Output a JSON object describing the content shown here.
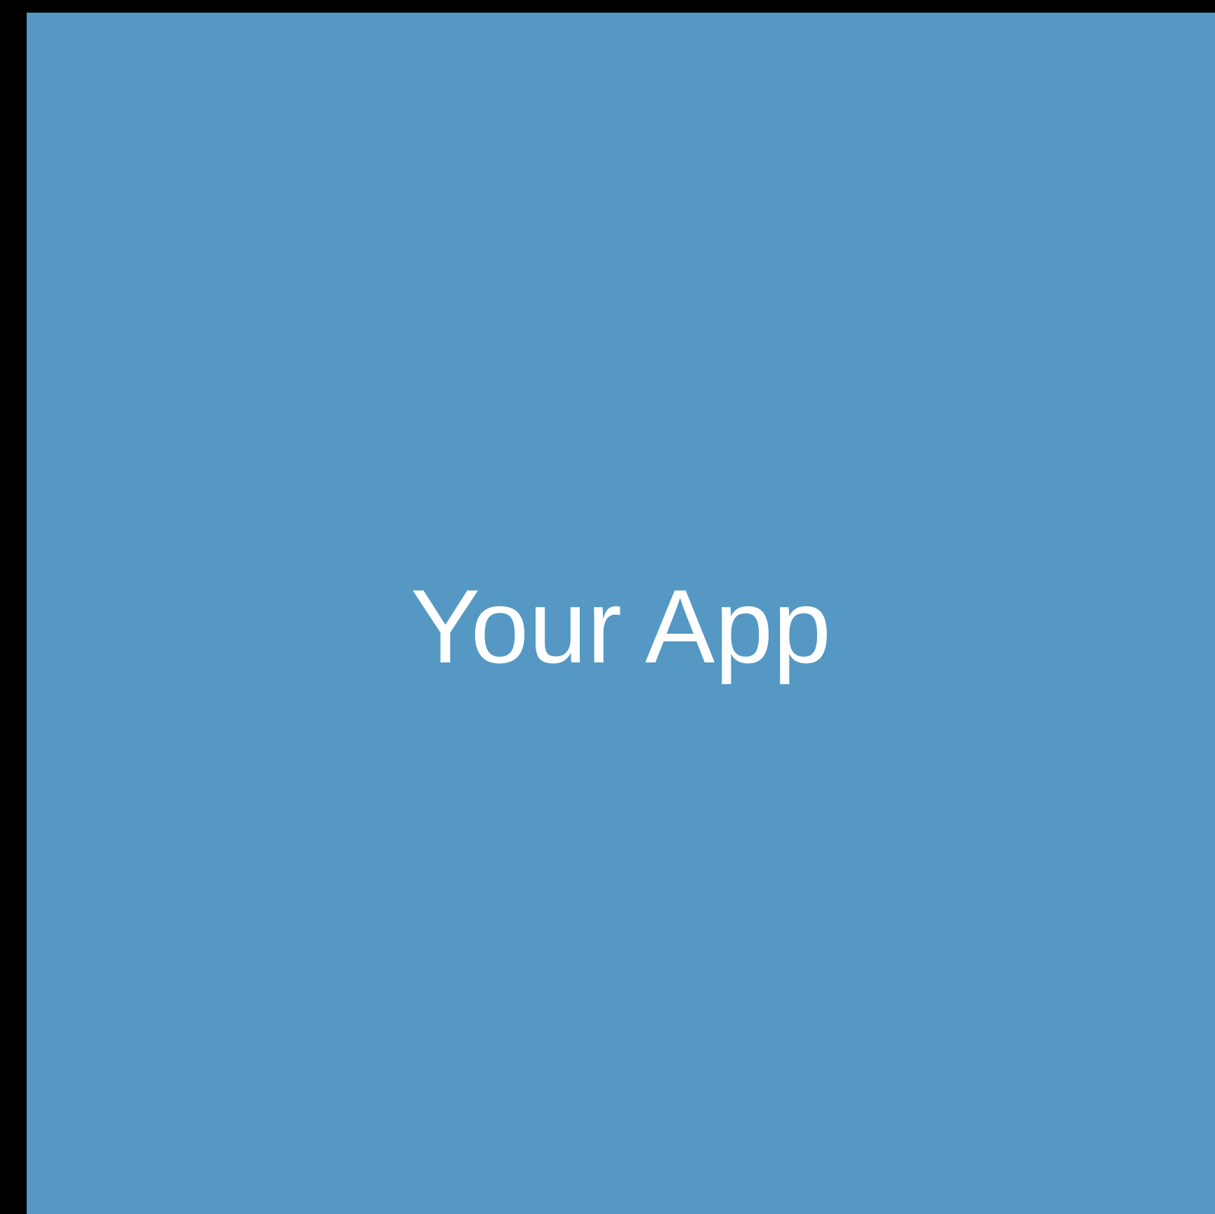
{
  "app": {
    "title": "Your App"
  },
  "colors": {
    "outer_background": "#000000",
    "panel_background": "#5498c3",
    "title_text": "#ffffff"
  }
}
